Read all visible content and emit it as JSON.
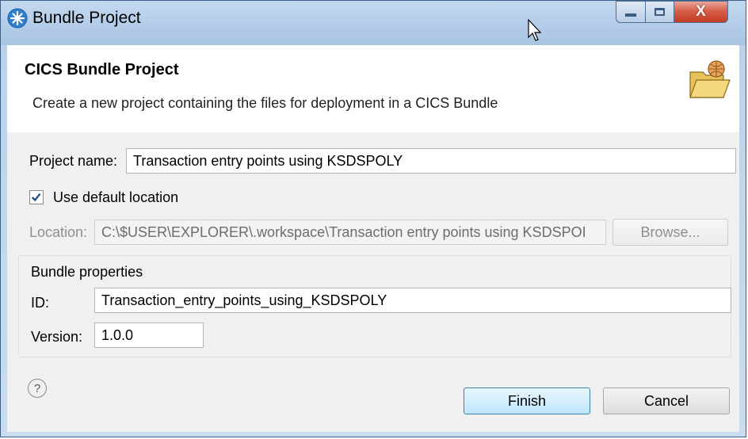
{
  "window": {
    "title": "Bundle Project",
    "controls": {
      "minimize": "minimize",
      "maximize": "maximize",
      "close": "X"
    }
  },
  "header": {
    "title": "CICS Bundle Project",
    "description": "Create a new project containing the files for deployment in a CICS Bundle"
  },
  "form": {
    "project_name_label": "Project name:",
    "project_name_value": "Transaction entry points using KSDSPOLY",
    "use_default_label": "Use default location",
    "use_default_checked": true,
    "location_label": "Location:",
    "location_value": "C:\\$USER\\EXPLORER\\.workspace\\Transaction entry points using KSDSPOI",
    "browse_label": "Browse..."
  },
  "bundle": {
    "group_label": "Bundle properties",
    "id_label": "ID:",
    "id_value": "Transaction_entry_points_using_KSDSPOLY",
    "version_label": "Version:",
    "version_value": "1.0.0"
  },
  "footer": {
    "help_symbol": "?",
    "finish_label": "Finish",
    "cancel_label": "Cancel"
  },
  "icons": {
    "app": "bundle-star-icon",
    "header": "folder-with-globe-icon",
    "help": "help-icon",
    "cursor": "mouse-pointer-icon"
  },
  "colors": {
    "window_frame": "#b9d1ea",
    "close_button": "#c63a22",
    "default_button": "#bde6fd"
  }
}
